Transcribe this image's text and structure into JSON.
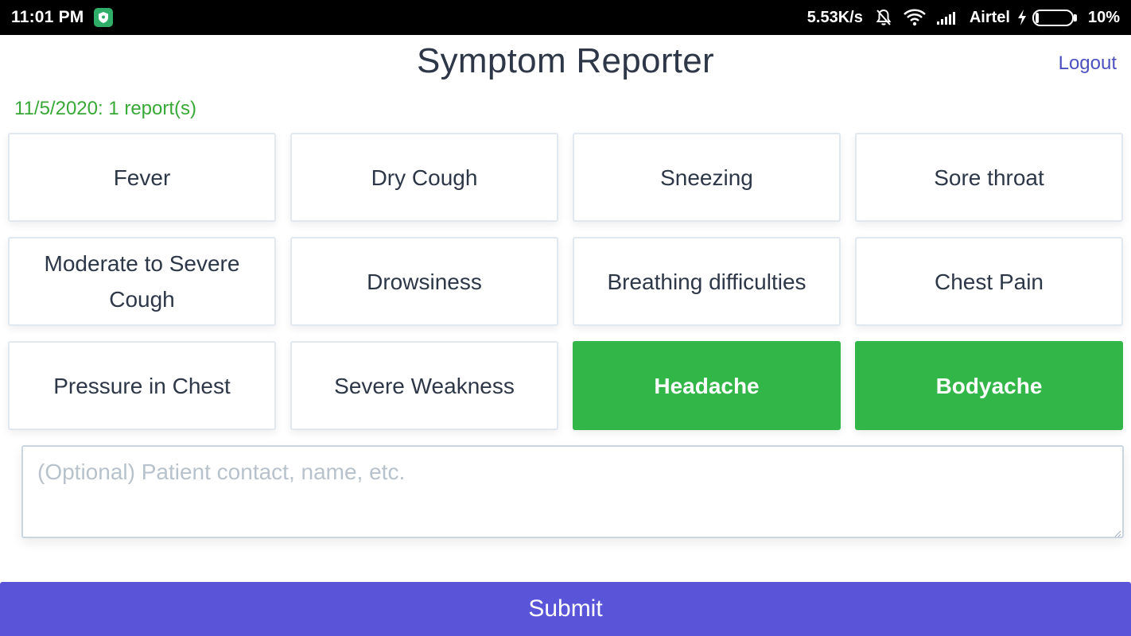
{
  "status_bar": {
    "time": "11:01 PM",
    "network_speed": "5.53K/s",
    "carrier": "Airtel",
    "battery_percent": "10%",
    "battery_level": 0.1,
    "icons": [
      "vpn-shield-icon",
      "notifications-muted-icon",
      "wifi-icon",
      "signal-icon",
      "charging-icon",
      "battery-icon"
    ]
  },
  "header": {
    "title": "Symptom Reporter",
    "logout_label": "Logout"
  },
  "report_summary": "11/5/2020: 1 report(s)",
  "symptoms": [
    {
      "label": "Fever",
      "selected": false
    },
    {
      "label": "Dry Cough",
      "selected": false
    },
    {
      "label": "Sneezing",
      "selected": false
    },
    {
      "label": "Sore throat",
      "selected": false
    },
    {
      "label": "Moderate to Severe Cough",
      "selected": false
    },
    {
      "label": "Drowsiness",
      "selected": false
    },
    {
      "label": "Breathing difficulties",
      "selected": false
    },
    {
      "label": "Chest Pain",
      "selected": false
    },
    {
      "label": "Pressure in Chest",
      "selected": false
    },
    {
      "label": "Severe Weakness",
      "selected": false
    },
    {
      "label": "Headache",
      "selected": true
    },
    {
      "label": "Bodyache",
      "selected": true
    }
  ],
  "notes": {
    "value": "",
    "placeholder": "(Optional) Patient contact, name, etc."
  },
  "submit_label": "Submit",
  "colors": {
    "selected": "#33b648",
    "submit": "#5a54d9",
    "link": "#4c51bf",
    "report_text": "#38a936",
    "text": "#2d3748"
  }
}
